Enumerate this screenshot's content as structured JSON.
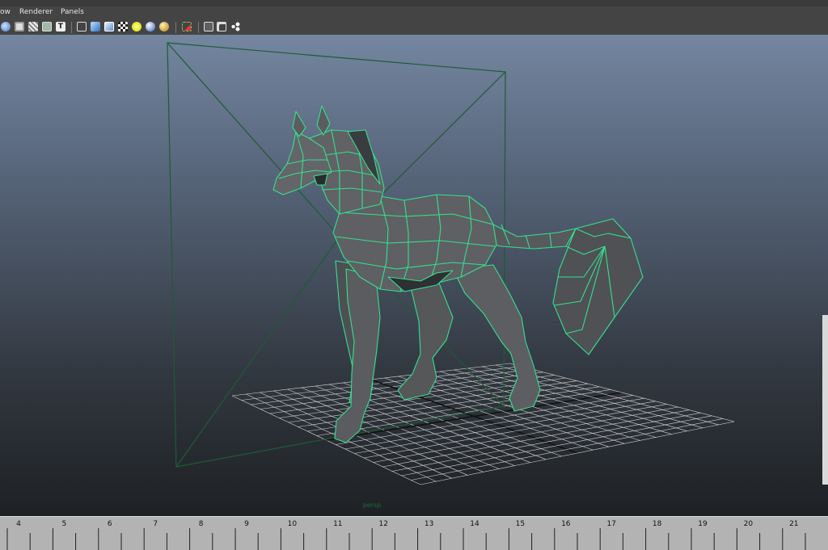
{
  "menu": {
    "window_partial": "ow",
    "renderer": "Renderer",
    "panels": "Panels"
  },
  "toolbar_icons": [
    "render-sphere-icon",
    "snapshot-icon",
    "grid-wire-icon",
    "camera-overlay-icon",
    "text-icon",
    "wireframe-cube-icon",
    "smooth-shade-cube-icon",
    "shaded-cube-icon",
    "checker-texture-icon",
    "light-bulb-icon",
    "shadow-sphere-icon",
    "ambient-occlusion-icon",
    "isolate-select-icon",
    "xray-cube-icon",
    "xray-joints-icon",
    "graph-node-icon"
  ],
  "viewport": {
    "camera_label": "persp"
  },
  "timeline": {
    "frames": [
      "4",
      "5",
      "6",
      "7",
      "8",
      "9",
      "10",
      "11",
      "12",
      "13",
      "14",
      "15",
      "16",
      "17",
      "18",
      "19",
      "20",
      "21"
    ]
  },
  "colors": {
    "wire": "#35e090",
    "mesh_fill": "#5b5d60",
    "grid": "#d6d6d6",
    "camera_frustum": "#1e5b35"
  }
}
